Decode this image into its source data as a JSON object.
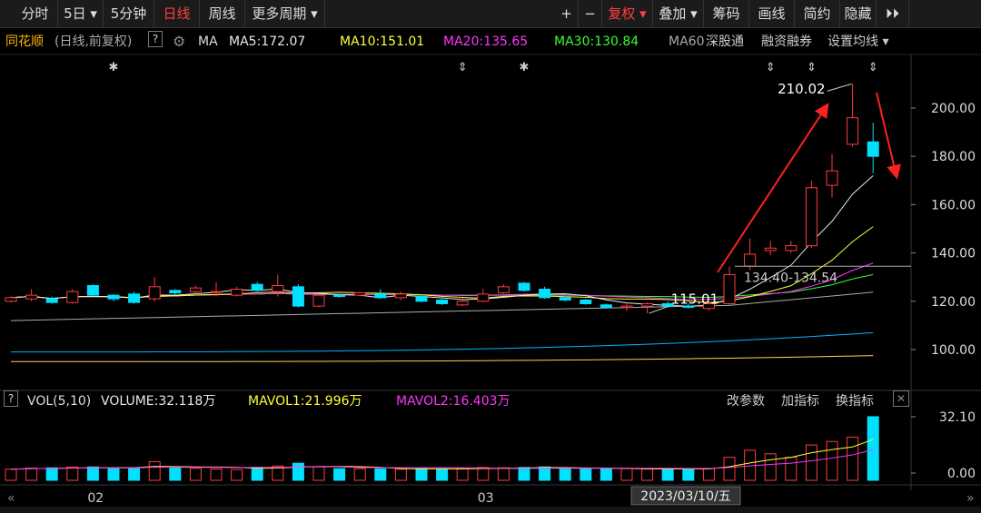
{
  "toolbar": {
    "items": [
      "分时",
      "5日 ▾",
      "5分钟",
      "日线",
      "周线",
      "更多周期 ▾"
    ],
    "right_items": [
      "+",
      "−",
      "复权 ▾",
      "叠加 ▾",
      "筹码",
      "画线",
      "简约",
      "隐藏",
      "⏵⏵"
    ],
    "active": "日线"
  },
  "info": {
    "name": "同花顺",
    "mode": "(日线,前复权)",
    "help": "?",
    "ma_label": "MA",
    "ma5": "MA5:172.07",
    "ma10": "MA10:151.01",
    "ma20": "MA20:135.65",
    "ma30": "MA30:130.84",
    "ma60": "MA60",
    "links": [
      "深股通",
      "融资融券",
      "设置均线 ▾"
    ],
    "arrow": "↑"
  },
  "volume_info": {
    "help": "?",
    "label": "VOL(5,10)",
    "volume": "VOLUME:32.118万",
    "mavol1": "MAVOL1:21.996万",
    "mavol2": "MAVOL2:16.403万",
    "arrow": "↑",
    "buttons": [
      "改参数",
      "加指标",
      "换指标"
    ],
    "close": "✕"
  },
  "annotations": {
    "high": "210.02",
    "low": "115.01",
    "gap": "134.40-134.54"
  },
  "date_tooltip": "2023/03/10/五",
  "colors": {
    "up": "#ff3c3c",
    "down": "#00e0ff",
    "ma5": "#e8e8e8",
    "ma10": "#ffff33",
    "ma20": "#ff33ff",
    "ma30": "#33ff33",
    "ma60": "#aaaaaa",
    "ma120": "#00b4ff",
    "ma250": "#ffd34d"
  },
  "chart_data": {
    "type": "candlestick",
    "y_ticks": [
      100,
      120,
      140,
      160,
      180,
      200
    ],
    "y_tick_labels": [
      "100.00",
      "120.00",
      "140.00",
      "160.00",
      "180.00",
      "200.00"
    ],
    "ylim": [
      91,
      216
    ],
    "x_labels": [
      {
        "label": "02",
        "index": 4
      },
      {
        "label": "03",
        "index": 23
      }
    ],
    "candles": [
      {
        "o": 120,
        "c": 121.5,
        "h": 122,
        "l": 119.5,
        "v": 2.2
      },
      {
        "o": 121,
        "c": 122.5,
        "h": 125,
        "l": 120,
        "v": 2.8
      },
      {
        "o": 121,
        "c": 119.5,
        "h": 122,
        "l": 119,
        "v": 3.0
      },
      {
        "o": 119.5,
        "c": 124,
        "h": 125,
        "l": 119,
        "v": 3.4
      },
      {
        "o": 126.5,
        "c": 122.5,
        "h": 127,
        "l": 122,
        "v": 3.5
      },
      {
        "o": 122.5,
        "c": 121,
        "h": 123,
        "l": 120,
        "v": 2.5
      },
      {
        "o": 123,
        "c": 119.5,
        "h": 124,
        "l": 119,
        "v": 2.8
      },
      {
        "o": 121,
        "c": 126,
        "h": 130,
        "l": 120,
        "v": 6.5
      },
      {
        "o": 124.5,
        "c": 123.5,
        "h": 125,
        "l": 122.5,
        "v": 3.0
      },
      {
        "o": 124,
        "c": 125.5,
        "h": 126.5,
        "l": 123,
        "v": 2.7
      },
      {
        "o": 124,
        "c": 124,
        "h": 128,
        "l": 122,
        "v": 2.3
      },
      {
        "o": 122.5,
        "c": 125,
        "h": 126,
        "l": 122,
        "v": 2.0
      },
      {
        "o": 127,
        "c": 124.5,
        "h": 128,
        "l": 124,
        "v": 3.3
      },
      {
        "o": 124,
        "c": 126.5,
        "h": 131,
        "l": 122,
        "v": 4.0
      },
      {
        "o": 126,
        "c": 118,
        "h": 127,
        "l": 117.5,
        "v": 5.6
      },
      {
        "o": 118,
        "c": 122.5,
        "h": 123,
        "l": 117.5,
        "v": 3.5
      },
      {
        "o": 122.5,
        "c": 122,
        "h": 123,
        "l": 121.5,
        "v": 2.5
      },
      {
        "o": 122.5,
        "c": 123.5,
        "h": 124,
        "l": 122,
        "v": 2.5
      },
      {
        "o": 123,
        "c": 121.5,
        "h": 125,
        "l": 121,
        "v": 2.4
      },
      {
        "o": 121.5,
        "c": 123,
        "h": 124,
        "l": 120.5,
        "v": 2.2
      },
      {
        "o": 122,
        "c": 120,
        "h": 123,
        "l": 119.5,
        "v": 2.5
      },
      {
        "o": 120.5,
        "c": 119,
        "h": 121,
        "l": 118.5,
        "v": 2.4
      },
      {
        "o": 118.5,
        "c": 120,
        "h": 121.5,
        "l": 118,
        "v": 2.5
      },
      {
        "o": 120,
        "c": 123,
        "h": 125,
        "l": 119.5,
        "v": 3.2
      },
      {
        "o": 123.5,
        "c": 126,
        "h": 127,
        "l": 123,
        "v": 3.0
      },
      {
        "o": 127.5,
        "c": 124.5,
        "h": 128,
        "l": 124,
        "v": 3.2
      },
      {
        "o": 125,
        "c": 121.5,
        "h": 126,
        "l": 121,
        "v": 3.5
      },
      {
        "o": 121.5,
        "c": 120.5,
        "h": 122,
        "l": 120,
        "v": 2.5
      },
      {
        "o": 120.5,
        "c": 119,
        "h": 121,
        "l": 118.5,
        "v": 2.3
      },
      {
        "o": 118.5,
        "c": 117.5,
        "h": 119,
        "l": 117,
        "v": 2.4
      },
      {
        "o": 117.5,
        "c": 118,
        "h": 119,
        "l": 116,
        "v": 2.6
      },
      {
        "o": 118,
        "c": 119,
        "h": 119.5,
        "l": 115.01,
        "v": 2.3
      },
      {
        "o": 119,
        "c": 118,
        "h": 120,
        "l": 117.5,
        "v": 2.0
      },
      {
        "o": 118,
        "c": 117.5,
        "h": 119,
        "l": 117,
        "v": 2.2
      },
      {
        "o": 117,
        "c": 119,
        "h": 120,
        "l": 116,
        "v": 2.6
      },
      {
        "o": 119,
        "c": 131,
        "h": 134.4,
        "l": 118.5,
        "v": 9.0
      },
      {
        "o": 134.54,
        "c": 139.5,
        "h": 146,
        "l": 133,
        "v": 13.0
      },
      {
        "o": 141,
        "c": 142,
        "h": 145,
        "l": 139,
        "v": 11.0
      },
      {
        "o": 141,
        "c": 143,
        "h": 145,
        "l": 140,
        "v": 9.0
      },
      {
        "o": 143,
        "c": 167,
        "h": 170,
        "l": 142,
        "v": 16.0
      },
      {
        "o": 168,
        "c": 174,
        "h": 181,
        "l": 163,
        "v": 18.0
      },
      {
        "o": 185,
        "c": 196,
        "h": 210.02,
        "l": 184,
        "v": 20.5
      },
      {
        "o": 186,
        "c": 180,
        "h": 194,
        "l": 173,
        "v": 32.118
      }
    ],
    "vol_axis": {
      "ticks": [
        0,
        32.1
      ],
      "labels": [
        "0.00",
        "32.10"
      ]
    }
  }
}
